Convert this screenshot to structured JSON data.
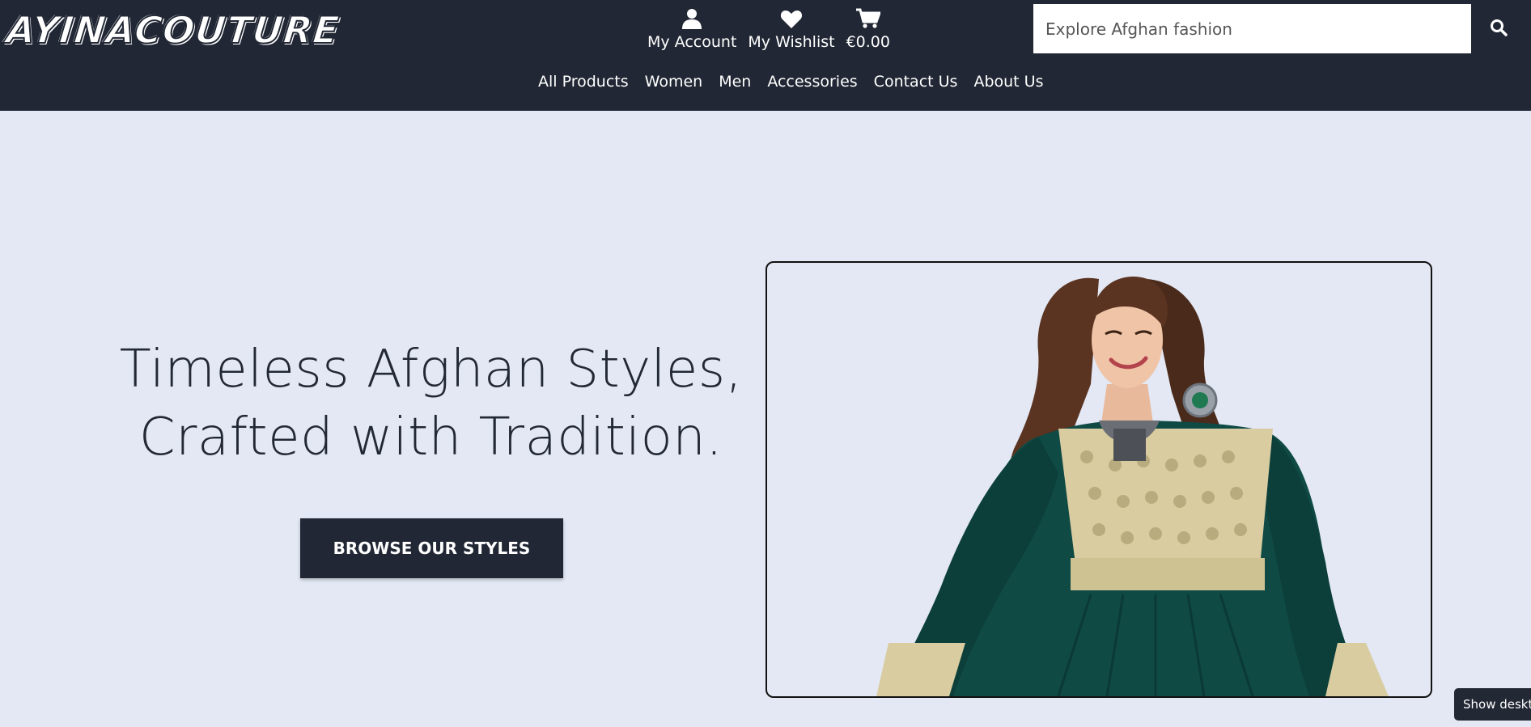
{
  "brand": {
    "logo_text": "AYINACOUTURE"
  },
  "account": {
    "my_account": "My Account",
    "my_wishlist": "My Wishlist",
    "cart_total": "€0.00"
  },
  "search": {
    "placeholder": "Explore Afghan fashion"
  },
  "nav": {
    "items": [
      "All Products",
      "Women",
      "Men",
      "Accessories",
      "Contact Us",
      "About Us"
    ]
  },
  "hero": {
    "title_line1": "Timeless Afghan Styles,",
    "title_line2": "Crafted with Tradition.",
    "cta_label": "BROWSE OUR STYLES"
  },
  "floating": {
    "show_desktop_label": "Show desktop"
  },
  "colors": {
    "header_bg": "#212734",
    "page_bg": "#e3e8f4",
    "dress_green": "#0f4a45",
    "embroidery_gold": "#d8cca0"
  }
}
